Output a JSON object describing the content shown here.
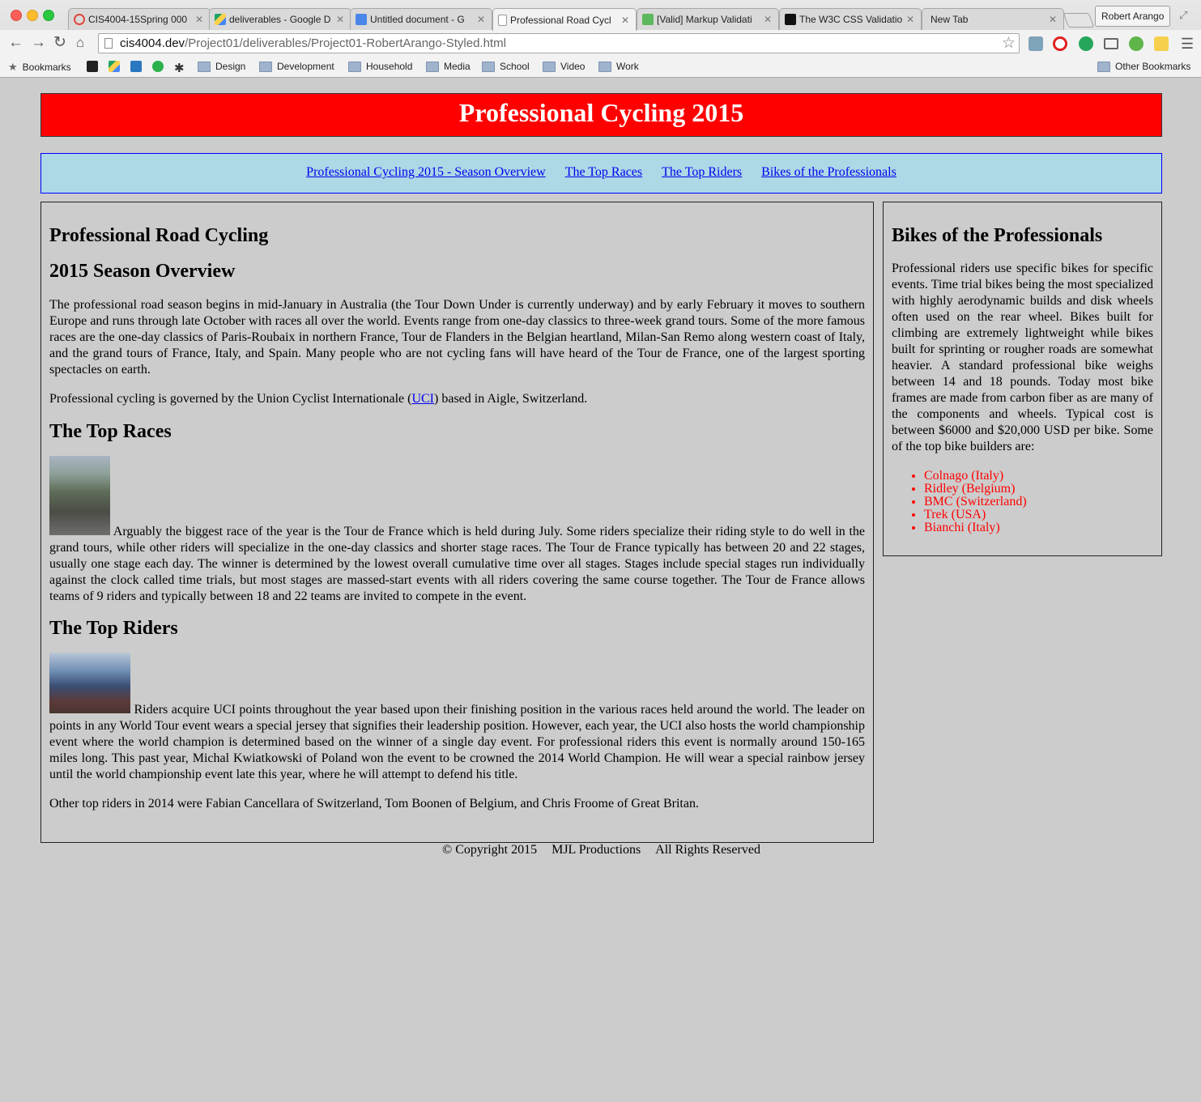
{
  "browser": {
    "tabs": [
      {
        "label": "CIS4004-15Spring 000",
        "color": "#e0473c"
      },
      {
        "label": "deliverables - Google D",
        "color": "#3b8bd6"
      },
      {
        "label": "Untitled document - G",
        "color": "#4a86e8"
      },
      {
        "label": "Professional Road Cycl",
        "color": "#ffffff"
      },
      {
        "label": "[Valid] Markup Validati",
        "color": "#5cb85c"
      },
      {
        "label": "The W3C CSS Validatio",
        "color": "#111111"
      },
      {
        "label": "New Tab",
        "color": "#d9d9d9"
      }
    ],
    "profile_name": "Robert Arango",
    "url_host": "cis4004.dev",
    "url_path": "/Project01/deliverables/Project01-RobertArango-Styled.html",
    "bookmarks_label": "Bookmarks",
    "bookmark_folders": [
      "Design",
      "Development",
      "Household",
      "Media",
      "School",
      "Video",
      "Work"
    ],
    "other_bookmarks": "Other Bookmarks"
  },
  "page": {
    "title": "Professional Cycling 2015",
    "nav_links": [
      "Professional Cycling 2015 - Season Overview",
      "The Top Races",
      "The Top Riders",
      "Bikes of the Professionals"
    ],
    "main": {
      "heading1": "Professional Road Cycling",
      "heading2": "2015 Season Overview",
      "overview_p1": "The professional road season begins in mid-January in Australia (the Tour Down Under is currently underway) and by early February it moves to southern Europe and runs through late October with races all over the world. Events range from one-day classics to three-week grand tours. Some of the more famous races are the one-day classics of Paris-Roubaix in northern France, Tour de Flanders in the Belgian heartland, Milan-San Remo along western coast of Italy, and the grand tours of France, Italy, and Spain. Many people who are not cycling fans will have heard of the Tour de France, one of the largest sporting spectacles on earth.",
      "overview_p2_before": "Professional cycling is governed by the Union Cyclist Internationale (",
      "overview_p2_link": "UCI",
      "overview_p2_after": ") based in Aigle, Switzerland.",
      "races_heading": "The Top Races",
      "races_text": "Arguably the biggest race of the year is the Tour de France which is held during July. Some riders specialize their riding style to do well in the grand tours, while other riders will specialize in the one-day classics and shorter stage races. The Tour de France typically has between 20 and 22 stages, usually one stage each day. The winner is determined by the lowest overall cumulative time over all stages. Stages include special stages run individually against the clock called time trials, but most stages are massed-start events with all riders covering the same course together. The Tour de France allows teams of 9 riders and typically between 18 and 22 teams are invited to compete in the event.",
      "riders_heading": "The Top Riders",
      "riders_text": "Riders acquire UCI points throughout the year based upon their finishing position in the various races held around the world. The leader on points in any World Tour event wears a special jersey that signifies their leadership position. However, each year, the UCI also hosts the world championship event where the world champion is determined based on the winner of a single day event. For professional riders this event is normally around 150-165 miles long. This past year, Michal Kwiatkowski of Poland won the event to be crowned the 2014 World Champion. He will wear a special rainbow jersey until the world championship event late this year, where he will attempt to defend his title.",
      "riders_p2": "Other top riders in 2014 were Fabian Cancellara of Switzerland, Tom Boonen of Belgium, and Chris Froome of Great Britan."
    },
    "aside": {
      "heading": "Bikes of the Professionals",
      "text": "Professional riders use specific bikes for specific events. Time trial bikes being the most specialized with highly aerodynamic builds and disk wheels often used on the rear wheel. Bikes built for climbing are extremely lightweight while bikes built for sprinting or rougher roads are somewhat heavier. A standard professional bike weighs between 14 and 18 pounds. Today most bike frames are made from carbon fiber as are many of the components and wheels. Typical cost is between $6000 and $20,000 USD per bike. Some of the top bike builders are:",
      "builders": [
        "Colnago (Italy)",
        "Ridley (Belgium)",
        "BMC (Switzerland)",
        "Trek (USA)",
        "Bianchi (Italy)"
      ]
    },
    "footer": [
      "© Copyright 2015",
      "MJL Productions",
      "All Rights Reserved"
    ]
  }
}
